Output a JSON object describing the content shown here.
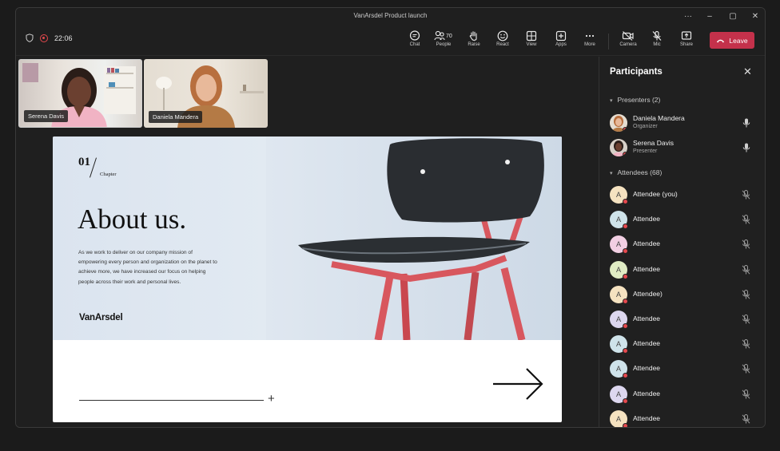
{
  "window": {
    "title": "VanArsdel Product launch"
  },
  "meeting": {
    "timer": "22:06"
  },
  "toolbar": {
    "chat": "Chat",
    "people": "People",
    "people_count": "70",
    "raise": "Raise",
    "react": "React",
    "view": "View",
    "apps": "Apps",
    "more": "More",
    "camera": "Camera",
    "mic": "Mic",
    "share": "Share",
    "leave": "Leave",
    "leave_color": "#c4314b"
  },
  "video_tiles": [
    {
      "name": "Serena Davis"
    },
    {
      "name": "Daniela Mandera"
    }
  ],
  "slide": {
    "chapter_number": "01",
    "chapter_label": "Chapter",
    "heading": "About us.",
    "body": "As we work to deliver on our company mission of empowering every person and organization on the planet to achieve more, we have increased our focus on helping people across their work and personal lives.",
    "brand": "VanArsdel"
  },
  "participants": {
    "title": "Participants",
    "presenters_header": "Presenters (2)",
    "attendees_header": "Attendees (68)",
    "presenters": [
      {
        "name": "Daniela Mandera",
        "role": "Organizer"
      },
      {
        "name": "Serena Davis",
        "role": "Presenter"
      }
    ],
    "attendees": [
      {
        "initial": "A",
        "name": "Attendee (you)",
        "color": "#f5e2c0"
      },
      {
        "initial": "A",
        "name": "Attendee",
        "color": "#cfe3ea"
      },
      {
        "initial": "A",
        "name": "Attendee",
        "color": "#f2cfe3"
      },
      {
        "initial": "A",
        "name": "Attendee",
        "color": "#e0ecc4"
      },
      {
        "initial": "A",
        "name": "Attendee)",
        "color": "#f5e2c0"
      },
      {
        "initial": "A",
        "name": "Attendee",
        "color": "#ddd7ef"
      },
      {
        "initial": "A",
        "name": "Attendee",
        "color": "#cfe3ea"
      },
      {
        "initial": "A",
        "name": "Attendee",
        "color": "#cfe3ea"
      },
      {
        "initial": "A",
        "name": "Attendee",
        "color": "#ddd7ef"
      },
      {
        "initial": "A",
        "name": "Attendee",
        "color": "#f5e2c0"
      }
    ]
  }
}
